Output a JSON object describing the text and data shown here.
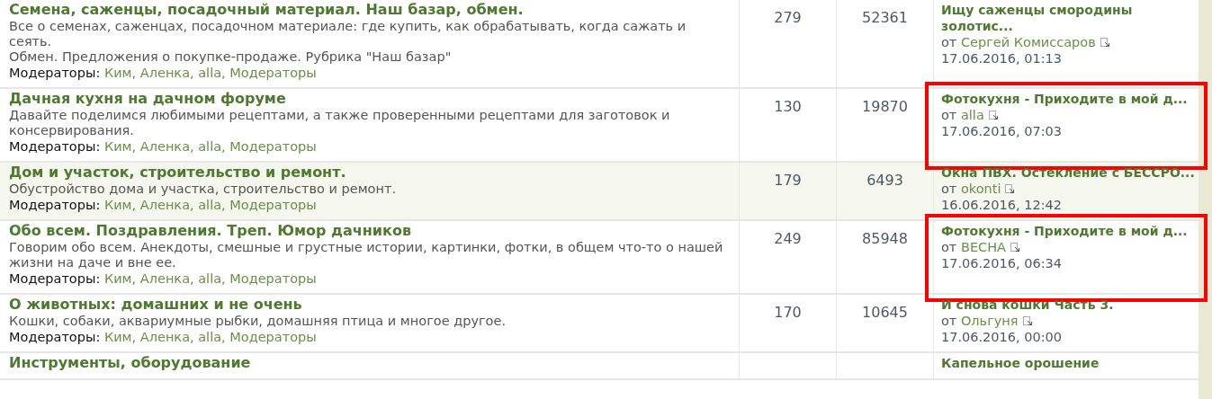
{
  "moderator_separator": ",",
  "forums": [
    {
      "title": "Семена, саженцы, посадочный материал. Наш базар, обмен.",
      "shaded": false,
      "description": [
        "Все о семенах, саженцах, посадочном материале: где купить, как обрабатывать, когда сажать и сеять.",
        "Обмен. Предложения о покупке-продаже. Рубрика \"Наш базар\""
      ],
      "moderators_label": "Модераторы:",
      "moderators": [
        "Ким",
        "Аленка",
        "alla",
        "Модераторы"
      ],
      "topics": "279",
      "posts": "52361",
      "last_post": {
        "title": "Ищу саженцы смородины золотис...",
        "by": "от",
        "author": "Сергей Комиссаров",
        "date": "17.06.2016, 01:13",
        "highlighted": false
      }
    },
    {
      "title": "Дачная кухня на дачном форуме",
      "shaded": false,
      "description": [
        "Давайте поделимся любимыми рецептами, а также проверенными рецептами для заготовок и консервирования."
      ],
      "moderators_label": "Модераторы:",
      "moderators": [
        "Ким",
        "Аленка",
        "alla",
        "Модераторы"
      ],
      "topics": "130",
      "posts": "19870",
      "last_post": {
        "title": "Фотокухня - Приходите в мой д...",
        "by": "от",
        "author": "alla",
        "date": "17.06.2016, 07:03",
        "highlighted": true
      }
    },
    {
      "title": "Дом и участок, строительство и ремонт.",
      "shaded": true,
      "description": [
        "Обустройство дома и участка, строительство и ремонт."
      ],
      "moderators_label": "Модераторы:",
      "moderators": [
        "Ким",
        "Аленка",
        "alla",
        "Модераторы"
      ],
      "topics": "179",
      "posts": "6493",
      "last_post": {
        "title": "Окна ПВХ. Остекление с БЕССРО...",
        "by": "от",
        "author": "okonti",
        "date": "16.06.2016, 12:42",
        "highlighted": false
      }
    },
    {
      "title": "Обо всем. Поздравления. Треп. Юмор дачников",
      "shaded": false,
      "description": [
        "Говорим обо всем. Анекдоты, смешные и грустные истории, картинки, фотки, в общем что-то о нашей жизни на даче и вне ее."
      ],
      "moderators_label": "Модераторы:",
      "moderators": [
        "Ким",
        "Аленка",
        "alla",
        "Модераторы"
      ],
      "topics": "249",
      "posts": "85948",
      "last_post": {
        "title": "Фотокухня - Приходите в мой д...",
        "by": "от",
        "author": "ВЕСНА",
        "date": "17.06.2016, 06:34",
        "highlighted": true
      }
    },
    {
      "title": "О животных: домашних и не очень",
      "shaded": false,
      "description": [
        "Кошки, собаки, аквариумные рыбки, домашняя птица и многое другое."
      ],
      "moderators_label": "Модераторы:",
      "moderators": [
        "Ким",
        "Аленка",
        "alla",
        "Модераторы"
      ],
      "topics": "170",
      "posts": "10645",
      "last_post": {
        "title": "И снова кошки Часть 3.",
        "by": "от",
        "author": "Ольгуня",
        "date": "17.06.2016, 00:00",
        "highlighted": false
      }
    },
    {
      "title": "Инструменты, оборудование",
      "shaded": false,
      "last_post": {
        "title": "Капельное орошение",
        "highlighted": false
      }
    }
  ]
}
